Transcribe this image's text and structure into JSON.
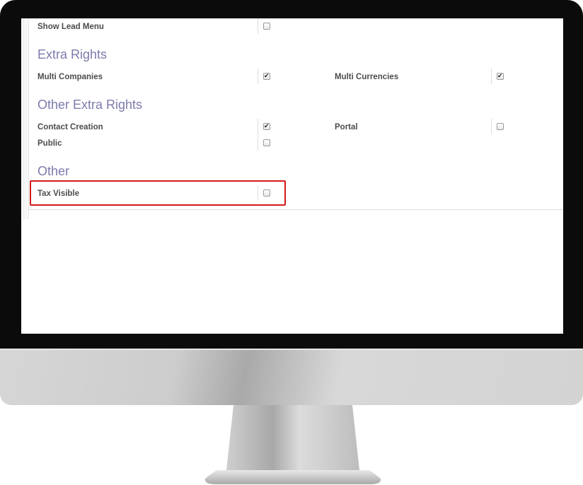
{
  "settings": {
    "top_row": {
      "label": "Show Lead Menu",
      "checked": false
    },
    "sections": [
      {
        "title": "Extra Rights",
        "rows": [
          {
            "left": {
              "label": "Multi Companies",
              "checked": true
            },
            "right": {
              "label": "Multi Currencies",
              "checked": true
            }
          }
        ]
      },
      {
        "title": "Other Extra Rights",
        "rows": [
          {
            "left": {
              "label": "Contact Creation",
              "checked": true
            },
            "right": {
              "label": "Portal",
              "checked": false
            }
          },
          {
            "left": {
              "label": "Public",
              "checked": false
            }
          }
        ]
      },
      {
        "title": "Other",
        "rows": [
          {
            "left": {
              "label": "Tax Visible",
              "checked": false
            }
          }
        ]
      }
    ]
  },
  "annotation": {
    "highlight_color": "#d21b1b",
    "highlighted_item": "Tax Visible"
  },
  "colors": {
    "section_title": "#7c7bad",
    "label": "#4c4c4c"
  }
}
